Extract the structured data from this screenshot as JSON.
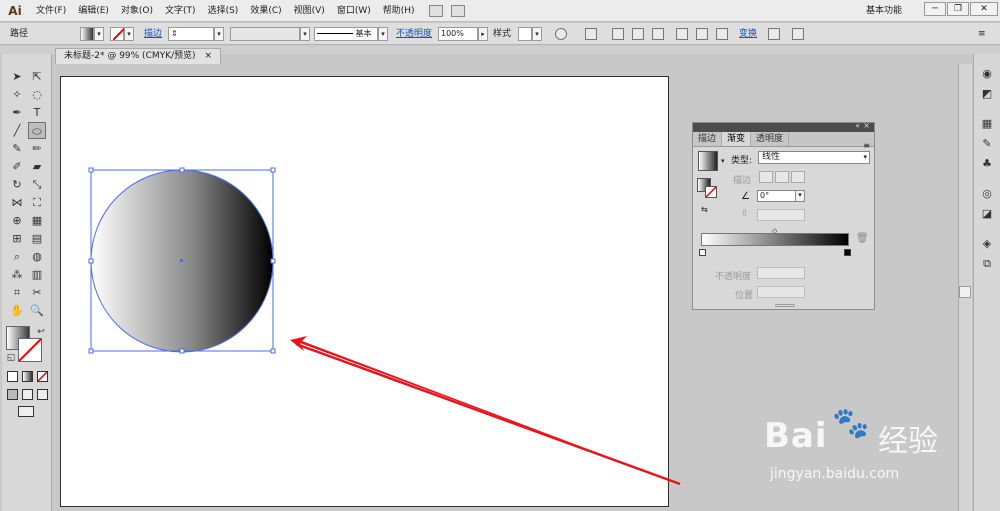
{
  "app": {
    "logo": "Ai",
    "workspace": "基本功能",
    "win_min": "─",
    "win_restore": "❐",
    "win_close": "✕"
  },
  "menu": [
    "文件(F)",
    "编辑(E)",
    "对象(O)",
    "文字(T)",
    "选择(S)",
    "效果(C)",
    "视图(V)",
    "窗口(W)",
    "帮助(H)"
  ],
  "control": {
    "selection_label": "路径",
    "stroke_label": "描边",
    "stroke_profile": "基本",
    "opacity_label": "不透明度",
    "opacity_value": "100%",
    "style_label": "样式",
    "transform_label": "变换"
  },
  "document": {
    "tab_title": "未标题-2* @ 99% (CMYK/预览)",
    "close": "×"
  },
  "gradient_panel": {
    "tabs": [
      "描边",
      "渐变",
      "透明度"
    ],
    "active_tab": "渐变",
    "type_label": "类型:",
    "type_value": "线性",
    "stroke_label": "描边",
    "angle_value": "0°",
    "opacity_label": "不透明度",
    "location_label": "位置",
    "delete_icon": "🗑"
  },
  "watermark": {
    "brand": "Bai",
    "brand_suffix": "经验",
    "url": "jingyan.baidu.com"
  },
  "colors": {
    "accent_link": "#1a52b7",
    "selection": "#4a6cf0",
    "arrow": "#e8141c"
  }
}
